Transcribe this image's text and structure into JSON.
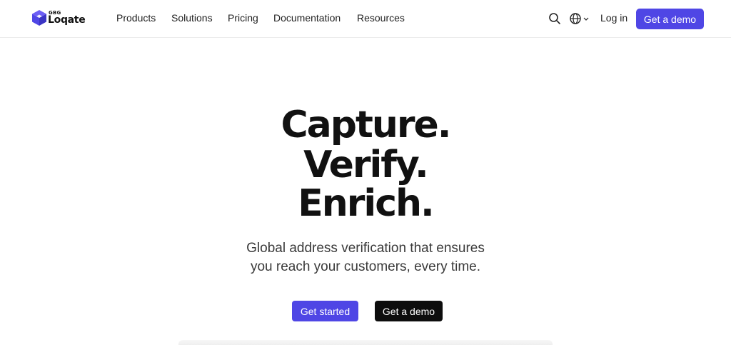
{
  "brand": {
    "parent": "GBG",
    "name": "Loqate",
    "accent": "#4f46e5"
  },
  "nav": {
    "products": "Products",
    "solutions": "Solutions",
    "pricing": "Pricing",
    "documentation": "Documentation",
    "resources": "Resources"
  },
  "header_actions": {
    "search_icon": "search-icon",
    "language_icon": "globe-icon",
    "login": "Log in",
    "demo": "Get a demo"
  },
  "hero": {
    "line1": "Capture.",
    "line2": "Verify.",
    "line3": "Enrich.",
    "subtitle_line1": "Global address verification that ensures",
    "subtitle_line2": "you reach your customers, every time.",
    "primary_cta": "Get started",
    "secondary_cta": "Get a demo"
  }
}
